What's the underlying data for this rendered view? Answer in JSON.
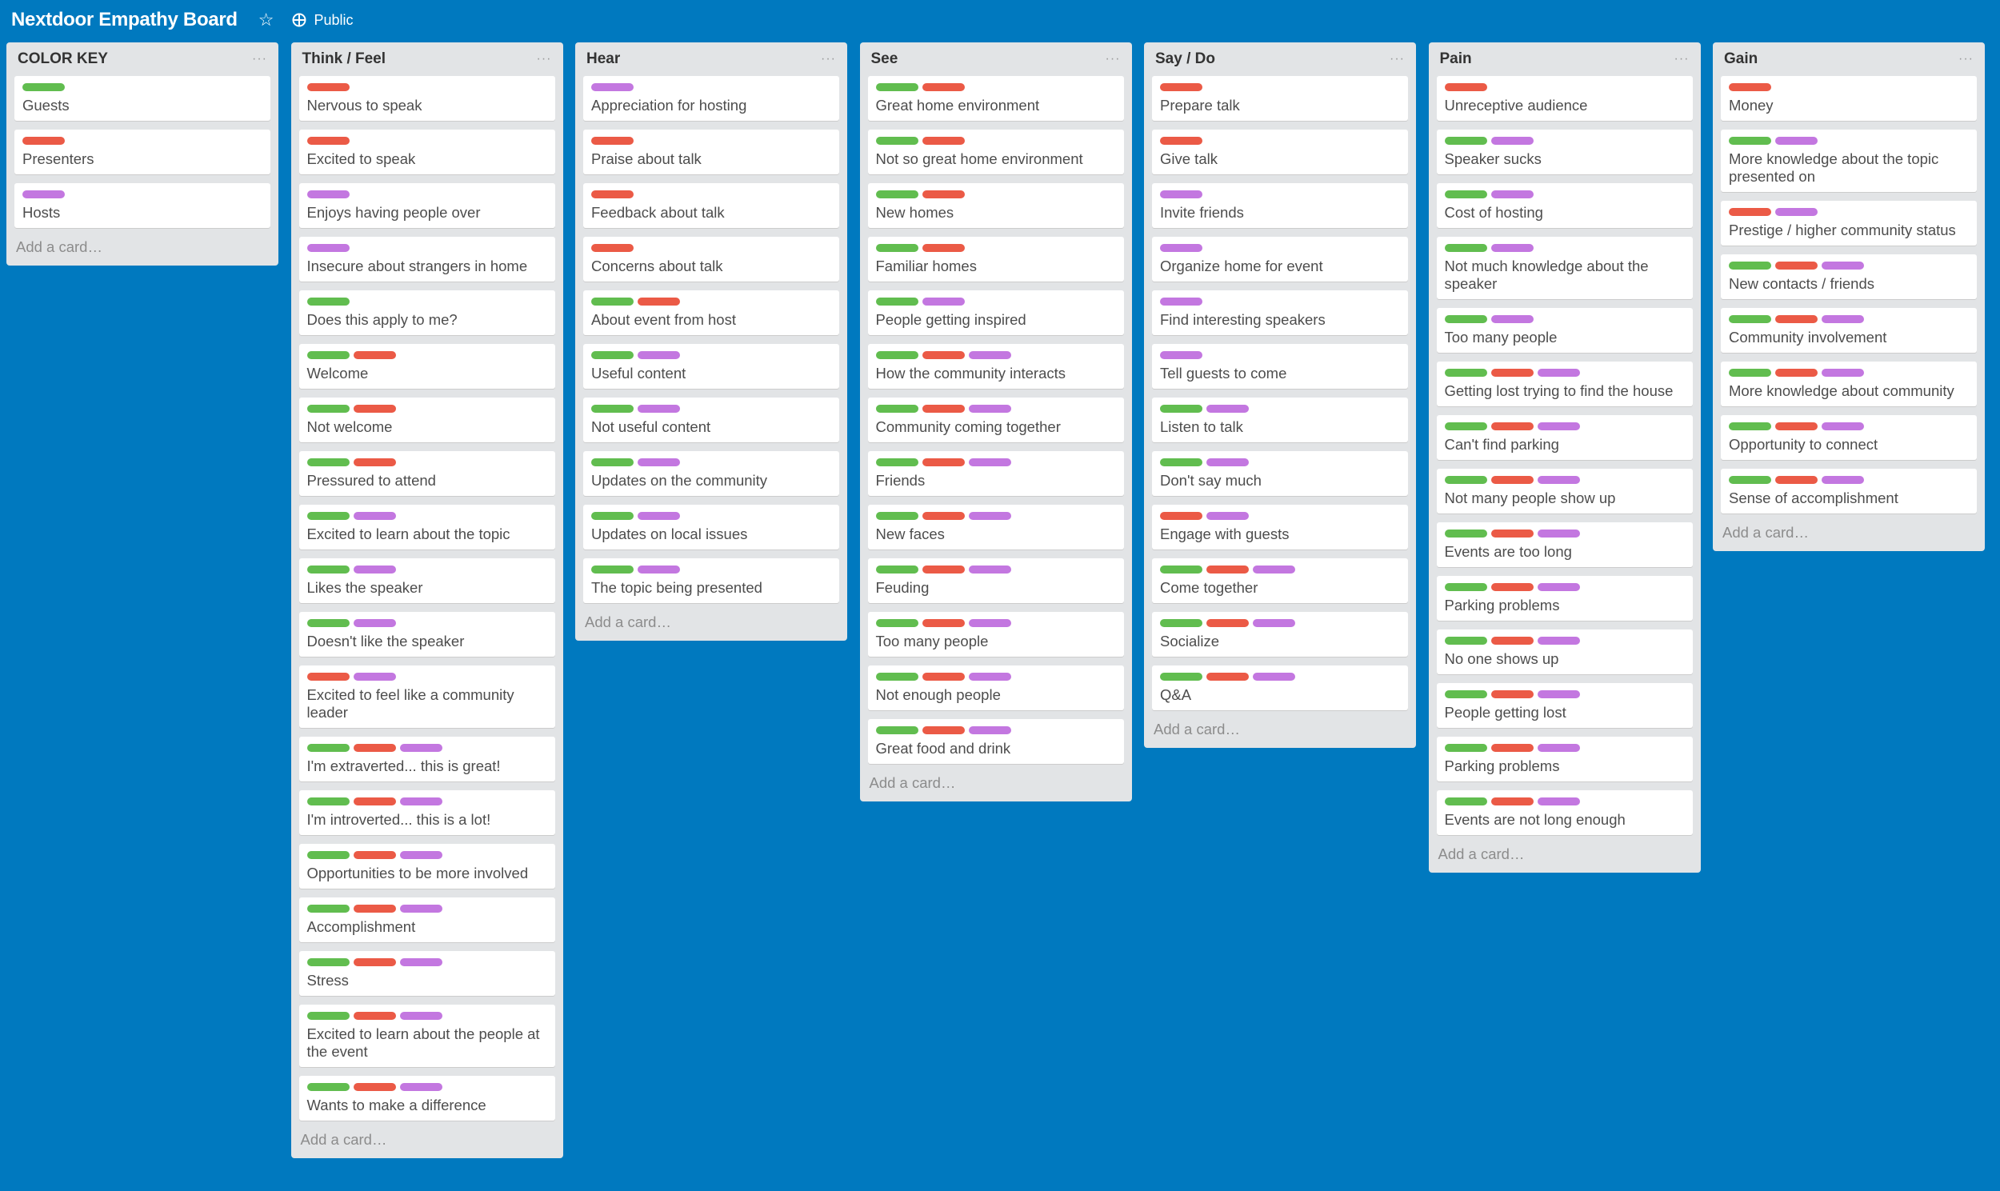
{
  "board": {
    "title": "Nextdoor Empathy Board",
    "visibility": "Public"
  },
  "add_card_label": "Add a card…",
  "list_menu_glyph": "···",
  "colors": {
    "background": "#0079BF",
    "green": "#61BD4F",
    "red": "#EB5A46",
    "purple": "#C377E0"
  },
  "lists": [
    {
      "title": "COLOR KEY",
      "cards": [
        {
          "labels": [
            "green"
          ],
          "text": "Guests"
        },
        {
          "labels": [
            "red"
          ],
          "text": "Presenters"
        },
        {
          "labels": [
            "purple"
          ],
          "text": "Hosts"
        }
      ]
    },
    {
      "title": "Think / Feel",
      "cards": [
        {
          "labels": [
            "red"
          ],
          "text": "Nervous to speak"
        },
        {
          "labels": [
            "red"
          ],
          "text": "Excited to speak"
        },
        {
          "labels": [
            "purple"
          ],
          "text": "Enjoys having people over"
        },
        {
          "labels": [
            "purple"
          ],
          "text": "Insecure about strangers in home"
        },
        {
          "labels": [
            "green"
          ],
          "text": "Does this apply to me?"
        },
        {
          "labels": [
            "green",
            "red"
          ],
          "text": "Welcome"
        },
        {
          "labels": [
            "green",
            "red"
          ],
          "text": "Not welcome"
        },
        {
          "labels": [
            "green",
            "red"
          ],
          "text": "Pressured to attend"
        },
        {
          "labels": [
            "green",
            "purple"
          ],
          "text": "Excited to learn about the topic"
        },
        {
          "labels": [
            "green",
            "purple"
          ],
          "text": "Likes the speaker"
        },
        {
          "labels": [
            "green",
            "purple"
          ],
          "text": "Doesn't like the speaker"
        },
        {
          "labels": [
            "red",
            "purple"
          ],
          "text": "Excited to feel like a community leader"
        },
        {
          "labels": [
            "green",
            "red",
            "purple"
          ],
          "text": "I'm extraverted... this is great!"
        },
        {
          "labels": [
            "green",
            "red",
            "purple"
          ],
          "text": "I'm introverted... this is a lot!"
        },
        {
          "labels": [
            "green",
            "red",
            "purple"
          ],
          "text": "Opportunities to be more involved"
        },
        {
          "labels": [
            "green",
            "red",
            "purple"
          ],
          "text": "Accomplishment"
        },
        {
          "labels": [
            "green",
            "red",
            "purple"
          ],
          "text": "Stress"
        },
        {
          "labels": [
            "green",
            "red",
            "purple"
          ],
          "text": "Excited to learn about the people at the event"
        },
        {
          "labels": [
            "green",
            "red",
            "purple"
          ],
          "text": "Wants to make a difference"
        }
      ]
    },
    {
      "title": "Hear",
      "cards": [
        {
          "labels": [
            "purple"
          ],
          "text": "Appreciation for hosting"
        },
        {
          "labels": [
            "red"
          ],
          "text": "Praise about talk"
        },
        {
          "labels": [
            "red"
          ],
          "text": "Feedback about talk"
        },
        {
          "labels": [
            "red"
          ],
          "text": "Concerns about talk"
        },
        {
          "labels": [
            "green",
            "red"
          ],
          "text": "About event from host"
        },
        {
          "labels": [
            "green",
            "purple"
          ],
          "text": "Useful content"
        },
        {
          "labels": [
            "green",
            "purple"
          ],
          "text": "Not useful content"
        },
        {
          "labels": [
            "green",
            "purple"
          ],
          "text": "Updates on the community"
        },
        {
          "labels": [
            "green",
            "purple"
          ],
          "text": "Updates on local issues"
        },
        {
          "labels": [
            "green",
            "purple"
          ],
          "text": "The topic being presented"
        }
      ]
    },
    {
      "title": "See",
      "cards": [
        {
          "labels": [
            "green",
            "red"
          ],
          "text": "Great home environment"
        },
        {
          "labels": [
            "green",
            "red"
          ],
          "text": "Not so great home environment"
        },
        {
          "labels": [
            "green",
            "red"
          ],
          "text": "New homes"
        },
        {
          "labels": [
            "green",
            "red"
          ],
          "text": "Familiar homes"
        },
        {
          "labels": [
            "green",
            "purple"
          ],
          "text": "People getting inspired"
        },
        {
          "labels": [
            "green",
            "red",
            "purple"
          ],
          "text": "How the community interacts"
        },
        {
          "labels": [
            "green",
            "red",
            "purple"
          ],
          "text": "Community coming together"
        },
        {
          "labels": [
            "green",
            "red",
            "purple"
          ],
          "text": "Friends"
        },
        {
          "labels": [
            "green",
            "red",
            "purple"
          ],
          "text": "New faces"
        },
        {
          "labels": [
            "green",
            "red",
            "purple"
          ],
          "text": "Feuding"
        },
        {
          "labels": [
            "green",
            "red",
            "purple"
          ],
          "text": "Too many people"
        },
        {
          "labels": [
            "green",
            "red",
            "purple"
          ],
          "text": "Not enough people"
        },
        {
          "labels": [
            "green",
            "red",
            "purple"
          ],
          "text": "Great food and drink"
        }
      ]
    },
    {
      "title": "Say / Do",
      "cards": [
        {
          "labels": [
            "red"
          ],
          "text": "Prepare talk"
        },
        {
          "labels": [
            "red"
          ],
          "text": "Give talk"
        },
        {
          "labels": [
            "purple"
          ],
          "text": "Invite friends"
        },
        {
          "labels": [
            "purple"
          ],
          "text": "Organize home for event"
        },
        {
          "labels": [
            "purple"
          ],
          "text": "Find interesting speakers"
        },
        {
          "labels": [
            "purple"
          ],
          "text": "Tell guests to come"
        },
        {
          "labels": [
            "green",
            "purple"
          ],
          "text": "Listen to talk"
        },
        {
          "labels": [
            "green",
            "purple"
          ],
          "text": "Don't say much"
        },
        {
          "labels": [
            "red",
            "purple"
          ],
          "text": "Engage with guests"
        },
        {
          "labels": [
            "green",
            "red",
            "purple"
          ],
          "text": "Come together"
        },
        {
          "labels": [
            "green",
            "red",
            "purple"
          ],
          "text": "Socialize"
        },
        {
          "labels": [
            "green",
            "red",
            "purple"
          ],
          "text": "Q&A"
        }
      ]
    },
    {
      "title": "Pain",
      "cards": [
        {
          "labels": [
            "red"
          ],
          "text": "Unreceptive audience"
        },
        {
          "labels": [
            "green",
            "purple"
          ],
          "text": "Speaker sucks"
        },
        {
          "labels": [
            "green",
            "purple"
          ],
          "text": "Cost of hosting"
        },
        {
          "labels": [
            "green",
            "purple"
          ],
          "text": "Not much knowledge about the speaker"
        },
        {
          "labels": [
            "green",
            "purple"
          ],
          "text": "Too many people"
        },
        {
          "labels": [
            "green",
            "red",
            "purple"
          ],
          "text": "Getting lost trying to find the house"
        },
        {
          "labels": [
            "green",
            "red",
            "purple"
          ],
          "text": "Can't find parking"
        },
        {
          "labels": [
            "green",
            "red",
            "purple"
          ],
          "text": "Not many people show up"
        },
        {
          "labels": [
            "green",
            "red",
            "purple"
          ],
          "text": "Events are too long"
        },
        {
          "labels": [
            "green",
            "red",
            "purple"
          ],
          "text": "Parking problems"
        },
        {
          "labels": [
            "green",
            "red",
            "purple"
          ],
          "text": "No one shows up"
        },
        {
          "labels": [
            "green",
            "red",
            "purple"
          ],
          "text": "People getting lost"
        },
        {
          "labels": [
            "green",
            "red",
            "purple"
          ],
          "text": "Parking problems"
        },
        {
          "labels": [
            "green",
            "red",
            "purple"
          ],
          "text": "Events are not long enough"
        }
      ]
    },
    {
      "title": "Gain",
      "cards": [
        {
          "labels": [
            "red"
          ],
          "text": "Money"
        },
        {
          "labels": [
            "green",
            "purple"
          ],
          "text": "More knowledge about the topic presented on"
        },
        {
          "labels": [
            "red",
            "purple"
          ],
          "text": "Prestige / higher community status"
        },
        {
          "labels": [
            "green",
            "red",
            "purple"
          ],
          "text": "New contacts / friends"
        },
        {
          "labels": [
            "green",
            "red",
            "purple"
          ],
          "text": "Community involvement"
        },
        {
          "labels": [
            "green",
            "red",
            "purple"
          ],
          "text": "More knowledge about community"
        },
        {
          "labels": [
            "green",
            "red",
            "purple"
          ],
          "text": "Opportunity to connect"
        },
        {
          "labels": [
            "green",
            "red",
            "purple"
          ],
          "text": "Sense of accomplishment"
        }
      ]
    }
  ]
}
